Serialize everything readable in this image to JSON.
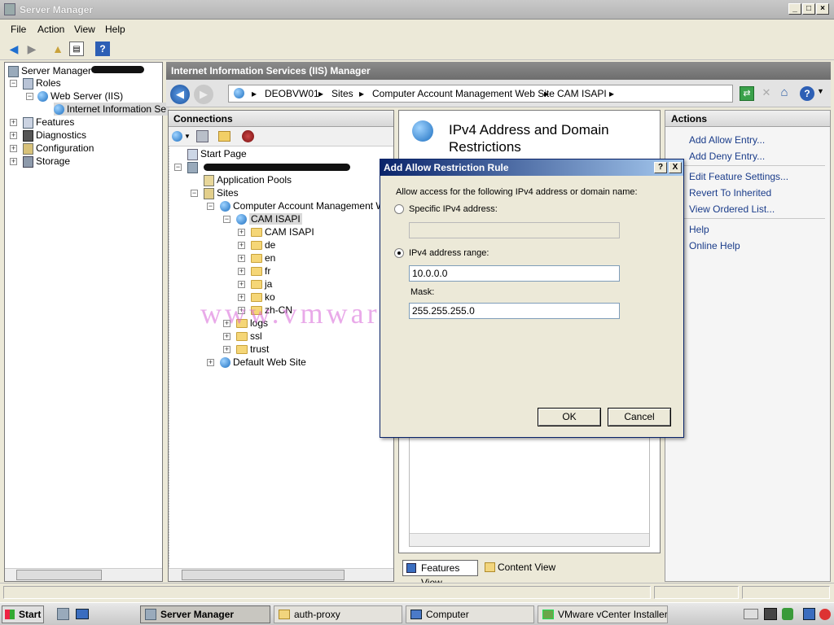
{
  "window": {
    "title": "Server Manager"
  },
  "menu": [
    "File",
    "Action",
    "View",
    "Help"
  ],
  "left_tree": [
    {
      "label": "Server Manager",
      "level": 0
    },
    {
      "label": "Roles",
      "level": 1
    },
    {
      "label": "Web Server (IIS)",
      "level": 2
    },
    {
      "label": "Internet Information Se",
      "level": 3
    },
    {
      "label": "Features",
      "level": 1
    },
    {
      "label": "Diagnostics",
      "level": 1
    },
    {
      "label": "Configuration",
      "level": 1
    },
    {
      "label": "Storage",
      "level": 1
    }
  ],
  "iis_header": "Internet Information Services (IIS) Manager",
  "breadcrumb": [
    "DEOBVW01",
    "Sites",
    "Computer Account Management Web Site",
    "CAM ISAPI"
  ],
  "connections": {
    "title": "Connections",
    "tree": [
      {
        "label": "Start Page"
      },
      {
        "label": "Application Pools"
      },
      {
        "label": "Sites"
      },
      {
        "label": "Computer Account Management Web"
      },
      {
        "label": "CAM ISAPI"
      },
      {
        "label": "CAM ISAPI"
      },
      {
        "label": "de"
      },
      {
        "label": "en"
      },
      {
        "label": "fr"
      },
      {
        "label": "ja"
      },
      {
        "label": "ko"
      },
      {
        "label": "zh-CN"
      },
      {
        "label": "logs"
      },
      {
        "label": "ssl"
      },
      {
        "label": "trust"
      },
      {
        "label": "Default Web Site"
      }
    ]
  },
  "feature": {
    "title_line1": "IPv4 Address and Domain",
    "title_line2": "Restrictions"
  },
  "view_tabs": {
    "features": "Features View",
    "content": "Content View"
  },
  "actions": {
    "title": "Actions",
    "items": [
      "Add Allow Entry...",
      "Add Deny Entry...",
      "Edit Feature Settings...",
      "Revert To Inherited",
      "View Ordered List...",
      "Help",
      "Online Help"
    ]
  },
  "dialog": {
    "title": "Add Allow Restriction Rule",
    "help_btn": "?",
    "close_btn": "X",
    "prompt": "Allow access for the following IPv4 address or domain name:",
    "specific_label": "Specific IPv4 address:",
    "range_label": "IPv4 address range:",
    "range_value": "10.0.0.0",
    "mask_label": "Mask:",
    "mask_value": "255.255.255.0",
    "selected": "range",
    "ok": "OK",
    "cancel": "Cancel"
  },
  "watermark": "www.vmwaremine.com",
  "taskbar": {
    "start": "Start",
    "tasks": [
      {
        "label": "Server Manager",
        "active": true
      },
      {
        "label": "auth-proxy",
        "active": false
      },
      {
        "label": "Computer",
        "active": false
      },
      {
        "label": "VMware vCenter Installer",
        "active": false
      }
    ]
  }
}
